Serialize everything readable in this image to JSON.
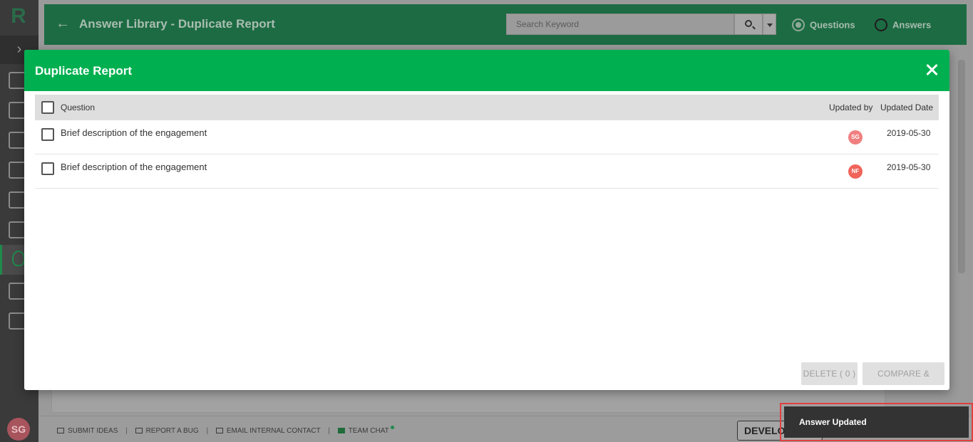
{
  "app": {
    "logo": "R",
    "user_initials": "SG"
  },
  "header": {
    "title": "Answer Library - Duplicate Report",
    "search_placeholder": "Search Keyword",
    "radio_questions": "Questions",
    "radio_answers": "Answers",
    "selected_radio": "Questions"
  },
  "footer": {
    "submit_ideas": "SUBMIT IDEAS",
    "report_bug": "REPORT A BUG",
    "email_contact": "EMAIL INTERNAL CONTACT",
    "team_chat": "TEAM CHAT",
    "environment": "DEVELO"
  },
  "modal": {
    "title": "Duplicate Report",
    "columns": {
      "question": "Question",
      "updated_by": "Updated by",
      "updated_date": "Updated Date"
    },
    "rows": [
      {
        "question": "Brief description of the engagement",
        "updated_by": "SG",
        "avatar_color": "#f08080",
        "updated_date": "2019-05-30"
      },
      {
        "question": "Brief description of the engagement",
        "updated_by": "NF",
        "avatar_color": "#f0645a",
        "updated_date": "2019-05-30"
      }
    ],
    "delete_label": "DELETE ( 0 )",
    "compare_label": "COMPARE & MERGE"
  },
  "toast": {
    "message": "Answer Updated"
  },
  "colors": {
    "accent": "#00b050",
    "header_bg": "#1d6b43"
  }
}
